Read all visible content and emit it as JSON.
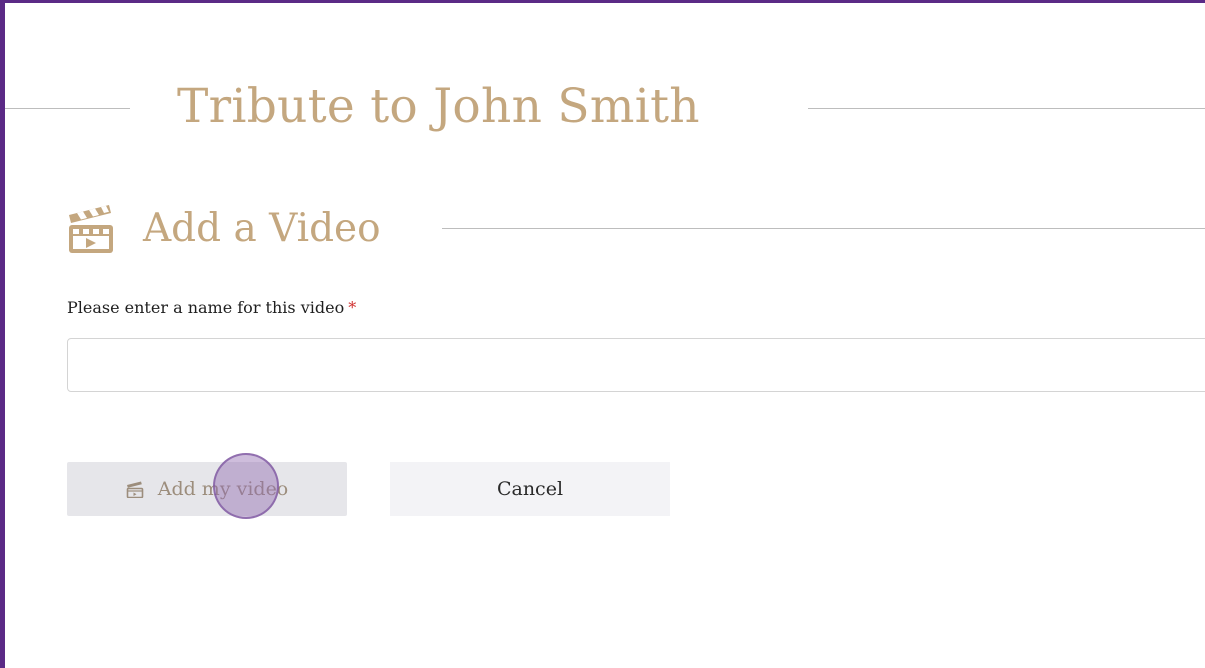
{
  "page": {
    "title": "Tribute to John Smith"
  },
  "section": {
    "title": "Add a Video",
    "icon": "clapperboard-icon"
  },
  "form": {
    "name_label": "Please enter a name for this video",
    "required_marker": "*",
    "name_value": "",
    "name_placeholder": ""
  },
  "buttons": {
    "add_label": "Add my video",
    "add_icon": "clapperboard-icon",
    "cancel_label": "Cancel"
  },
  "colors": {
    "frame_border": "#5b2a86",
    "accent_gold": "#c4a77f",
    "required_red": "#d0302f",
    "add_button_bg": "#e6e6ea",
    "cancel_button_bg": "#f3f3f6",
    "click_indicator": "#926cb2"
  }
}
